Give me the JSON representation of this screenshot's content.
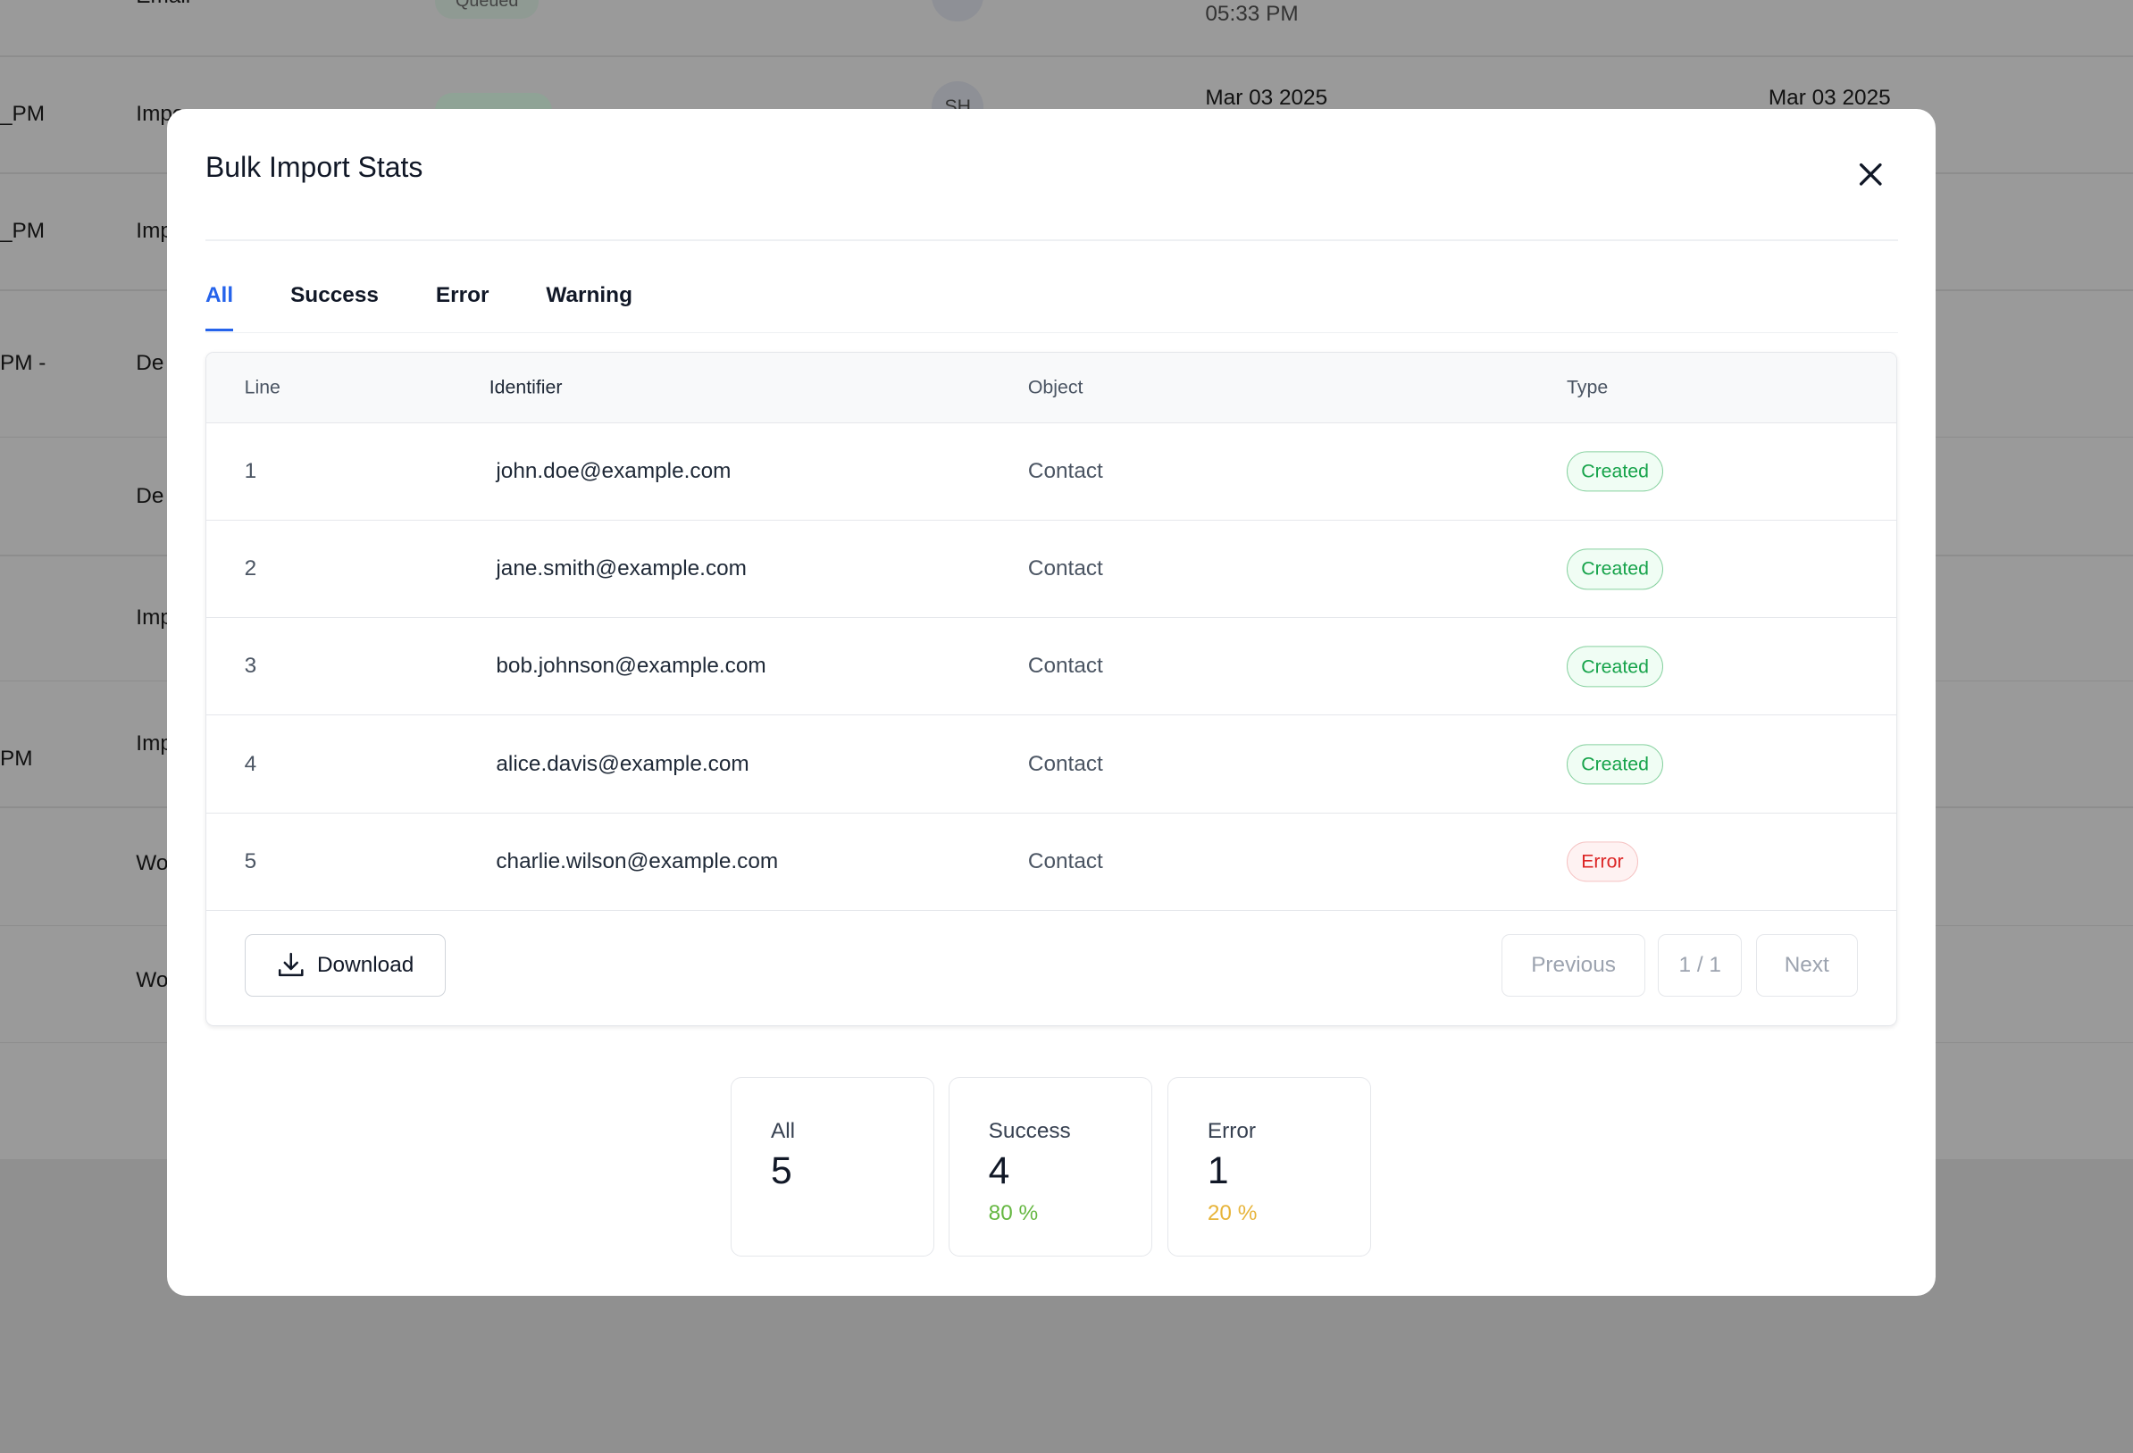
{
  "background": {
    "row0": {
      "type": "Email",
      "status": "Queued",
      "time": "05:33 PM"
    },
    "row1": {
      "time": "_PM",
      "type": "Impo",
      "avatar": "SH",
      "created": "Mar 03 2025",
      "updated": "Mar 03 2025"
    },
    "rows": [
      {
        "time": "_PM",
        "type": "Imp"
      },
      {
        "time": "PM -",
        "type": "De"
      },
      {
        "time": "",
        "type": "De"
      },
      {
        "time": "",
        "type": "Imp"
      },
      {
        "time": "PM",
        "type": "Imp"
      },
      {
        "time": "",
        "type": "Wo"
      },
      {
        "time": "",
        "type": "Wo"
      }
    ]
  },
  "modal": {
    "title": "Bulk Import Stats",
    "tabs": [
      {
        "label": "All",
        "active": true
      },
      {
        "label": "Success"
      },
      {
        "label": "Error"
      },
      {
        "label": "Warning"
      }
    ],
    "table": {
      "headers": [
        "Line",
        "Identifier",
        "Object",
        "Type"
      ],
      "rows": [
        {
          "line": "1",
          "identifier": "john.doe@example.com",
          "object": "Contact",
          "type": "Created"
        },
        {
          "line": "2",
          "identifier": "jane.smith@example.com",
          "object": "Contact",
          "type": "Created"
        },
        {
          "line": "3",
          "identifier": "bob.johnson@example.com",
          "object": "Contact",
          "type": "Created"
        },
        {
          "line": "4",
          "identifier": "alice.davis@example.com",
          "object": "Contact",
          "type": "Created"
        },
        {
          "line": "5",
          "identifier": "charlie.wilson@example.com",
          "object": "Contact",
          "type": "Error"
        }
      ]
    },
    "download_label": "Download",
    "pagination": {
      "previous": "Previous",
      "page": "1 / 1",
      "next": "Next"
    },
    "stats": [
      {
        "label": "All",
        "value": "5"
      },
      {
        "label": "Success",
        "value": "4",
        "percent": "80 %",
        "color": "#65b741"
      },
      {
        "label": "Error",
        "value": "1",
        "percent": "20 %",
        "color": "#e7b43a"
      }
    ]
  }
}
